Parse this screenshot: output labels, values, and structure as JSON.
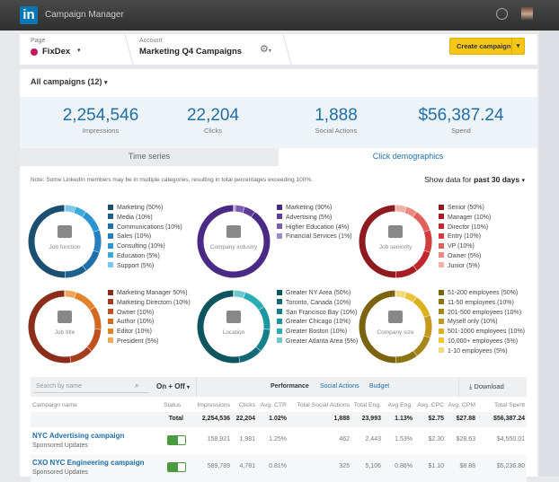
{
  "app": {
    "logo": "in",
    "title": "Campaign Manager"
  },
  "header": {
    "page_label": "Page",
    "page_value": "FixDex",
    "account_label": "Account",
    "account_value": "Marketing Q4 Campaigns",
    "create_label": "Create campaign"
  },
  "filter": {
    "all_campaigns": "All campaigns (12)"
  },
  "stats": [
    {
      "value": "2,254,546",
      "label": "Impressions"
    },
    {
      "value": "22,204",
      "label": "Clicks"
    },
    {
      "value": "1,888",
      "label": "Social Actions"
    },
    {
      "value": "$56,387.24",
      "label": "Spend"
    }
  ],
  "tabs": [
    "Time series",
    "Click demographics"
  ],
  "note": "Note: Some LinkedIn members may be in multiple categories, resulting in total percentages exceeding 100%.",
  "show_data": {
    "prefix": "Show data for",
    "value": "past 30 days"
  },
  "demographics": [
    {
      "title": "Job function",
      "icon": "briefcase-icon",
      "items": [
        [
          "Marketing (50%)",
          50,
          "#1b4f72"
        ],
        [
          "Media (10%)",
          10,
          "#1d5f8e"
        ],
        [
          "Communications (10%)",
          10,
          "#1f6fa8"
        ],
        [
          "Sales (10%)",
          10,
          "#2480be"
        ],
        [
          "Consulting (10%)",
          10,
          "#2a95d1"
        ],
        [
          "Education (5%)",
          5,
          "#3aaadf"
        ],
        [
          "Support (5%)",
          5,
          "#7cc8ea"
        ]
      ]
    },
    {
      "title": "Company industry",
      "icon": "building-icon",
      "items": [
        [
          "Marketing (90%)",
          90,
          "#4b2a85"
        ],
        [
          "Advertising (5%)",
          5,
          "#5d3b97"
        ],
        [
          "Higher Education (4%)",
          4,
          "#7c5bb3"
        ],
        [
          "Financial Services (1%)",
          1,
          "#a08bc9"
        ]
      ]
    },
    {
      "title": "Job seniority",
      "icon": "document-icon",
      "items": [
        [
          "Senior (50%)",
          50,
          "#8e1b1f"
        ],
        [
          "Manager (10%)",
          10,
          "#a81d23"
        ],
        [
          "Director (10%)",
          10,
          "#c0272d"
        ],
        [
          "Entry (10%)",
          10,
          "#d13f3c"
        ],
        [
          "VP (10%)",
          10,
          "#e0605a"
        ],
        [
          "Owner (5%)",
          5,
          "#ea8a80"
        ],
        [
          "Junior (5%)",
          5,
          "#f2b0a8"
        ]
      ]
    },
    {
      "title": "Job title",
      "icon": "resume-icon",
      "items": [
        [
          "Marketing Manager 50%)",
          50,
          "#8a2e1b"
        ],
        [
          "Marketing Directorn (10%)",
          10,
          "#a53d1c"
        ],
        [
          "Owner (10%)",
          10,
          "#c0521f"
        ],
        [
          "Author (10%)",
          10,
          "#d26a23"
        ],
        [
          "Editor (10%)",
          10,
          "#e2832b"
        ],
        [
          "President (5%)",
          5,
          "#eea75a"
        ]
      ]
    },
    {
      "title": "Location",
      "icon": "globe-icon",
      "items": [
        [
          "Greater NY Area (50%)",
          50,
          "#0f5560"
        ],
        [
          "Toronto, Canada (10%)",
          10,
          "#116a75"
        ],
        [
          "San Francisco Bay (10%)",
          10,
          "#13808a"
        ],
        [
          "Greater Chicago (10%)",
          10,
          "#1a979f"
        ],
        [
          "Greater Boston (10%)",
          10,
          "#2aacb2"
        ],
        [
          "Greater Atlanta Area (5%)",
          5,
          "#6cc8cb"
        ]
      ]
    },
    {
      "title": "Company size",
      "icon": "people-icon",
      "items": [
        [
          "51-200 employees (50%)",
          50,
          "#7a6410"
        ],
        [
          "11-50 employees (10%)",
          10,
          "#8e7514"
        ],
        [
          "201-500 employees (10%)",
          10,
          "#a8871a"
        ],
        [
          "Myself only (10%)",
          10,
          "#c49a1e"
        ],
        [
          "501-1000 employees (10%)",
          10,
          "#ddb020"
        ],
        [
          "10,000+ employees (5%)",
          5,
          "#ecc33a"
        ],
        [
          "1-10 employees (5%)",
          5,
          "#f3da80"
        ]
      ]
    }
  ],
  "table": {
    "search_placeholder": "Search by name",
    "status_filter": "On + Off",
    "views": [
      "Performance",
      "Social Actions",
      "Budget"
    ],
    "download": "Download",
    "columns": [
      "Campaign name",
      "Status",
      "Impressions",
      "Clicks",
      "Avg. CTR",
      "Total Social Actions",
      "Total Eng.",
      "Avg Eng.",
      "Avg. CPC",
      "Avg. CPM",
      "Total Spent"
    ],
    "total": {
      "label": "Total",
      "values": [
        "2,254,536",
        "22,204",
        "1.02%",
        "1,888",
        "23,993",
        "1.13%",
        "$2.75",
        "$27.88",
        "$56,387.24"
      ]
    },
    "rows": [
      {
        "name": "NYC Advertising campaign",
        "type": "Sponsored Updates",
        "status": "on",
        "values": [
          "158,921",
          "1,981",
          "1.25%",
          "462",
          "2,443",
          "1.53%",
          "$2.30",
          "$28.63",
          "$4,550.01"
        ]
      },
      {
        "name": "CXO NYC Engineering campaign",
        "type": "Sponsored Updates",
        "status": "on",
        "values": [
          "589,789",
          "4,781",
          "0.81%",
          "325",
          "5,106",
          "0.86%",
          "$1.10",
          "$8.88",
          "$5,236.80"
        ]
      }
    ]
  }
}
